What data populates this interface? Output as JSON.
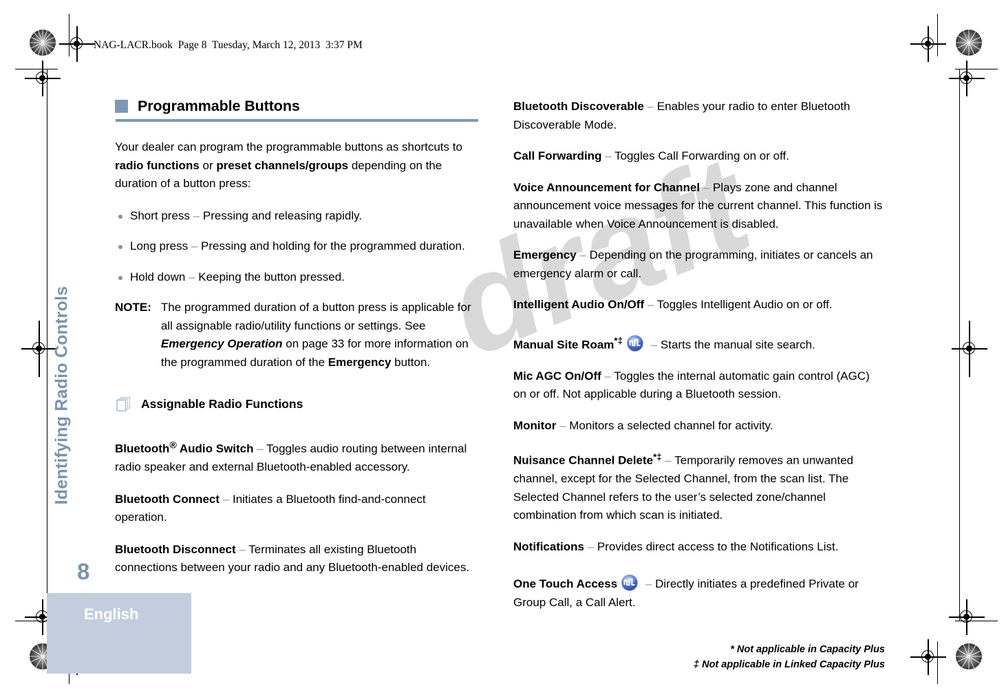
{
  "book_header": "NAG-LACR.book  Page 8  Tuesday, March 12, 2013  3:37 PM",
  "sidebar": {
    "chapter": "Identifying Radio Controls",
    "page_number": "8",
    "language": "English"
  },
  "watermark": "draft",
  "colors": {
    "accent": "#7d99b5",
    "sidebar_band": "#c2cedd",
    "sidebar_text": "#7d93ad",
    "dash": "#8095ad",
    "watermark": "#d9d9d9",
    "icon_blue": "#4a6fd4"
  },
  "left_column": {
    "heading": "Programmable Buttons",
    "heading_icon": "square-bullet-icon",
    "intro": {
      "part1": "Your dealer can program the programmable buttons as shortcuts to ",
      "bold1": "radio functions",
      "part2": " or ",
      "bold2": "preset channels/groups",
      "part3": " depending on the duration of a button press:"
    },
    "bullets": [
      {
        "term": "Short press",
        "dash": "–",
        "desc": " Pressing and releasing rapidly."
      },
      {
        "term": "Long press",
        "dash": "–",
        "desc": " Pressing and holding for the programmed duration."
      },
      {
        "term": "Hold down",
        "dash": "–",
        "desc": " Keeping the button pressed."
      }
    ],
    "note": {
      "label": "NOTE:",
      "part1": "The programmed duration of a button press is applicable for all assignable radio/utility functions or settings. See ",
      "ref": "Emergency Operation",
      "part2": " on page 33 for more information on the programmed duration of the ",
      "bold2": "Emergency",
      "part3": " button."
    },
    "subheading": "Assignable Radio Functions",
    "subheading_icon": "stacked-pages-icon",
    "entries": [
      {
        "term": "Bluetooth",
        "sup": "®",
        "term2": " Audio Switch",
        "dash": "–",
        "desc": " Toggles audio routing between internal radio speaker and external Bluetooth-enabled accessory."
      },
      {
        "term": "Bluetooth Connect",
        "dash": "–",
        "desc": " Initiates a Bluetooth find-and-connect operation."
      },
      {
        "term": "Bluetooth Disconnect",
        "dash": "–",
        "desc": " Terminates all existing Bluetooth connections between your radio and any Bluetooth-enabled devices."
      }
    ]
  },
  "right_column": {
    "entries": [
      {
        "term": "Bluetooth Discoverable",
        "dash": "–",
        "desc": " Enables your radio to enter Bluetooth Discoverable Mode."
      },
      {
        "term": "Call Forwarding",
        "dash": "–",
        "desc": " Toggles Call Forwarding on or off."
      },
      {
        "term": "Voice Announcement for Channel",
        "dash": "–",
        "desc": " Plays zone and channel announcement voice messages for the current channel. This function is unavailable when Voice Announcement is disabled."
      },
      {
        "term": "Emergency",
        "dash": "–",
        "desc": " Depending on the programming, initiates or cancels an emergency alarm or call."
      },
      {
        "term": "Intelligent Audio On/Off",
        "dash": "–",
        "desc": " Toggles Intelligent Audio on or off."
      },
      {
        "term": "Manual Site Roam",
        "marks": "*‡",
        "icon": "site-roam-button-icon",
        "dash": "–",
        "desc": " Starts the manual site search."
      },
      {
        "term": "Mic AGC On/Off",
        "dash": "–",
        "desc": " Toggles the internal  automatic gain control (AGC) on or off. Not applicable during a Bluetooth session."
      },
      {
        "term": "Monitor",
        "dash": "–",
        "desc": " Monitors a selected channel for activity."
      },
      {
        "term": "Nuisance Channel Delete",
        "marks": "*‡",
        "dash": "–",
        "desc": " Temporarily removes an unwanted channel, except for the Selected Channel, from the scan list. The Selected Channel refers to the user’s selected zone/channel combination from which scan is initiated."
      },
      {
        "term": "Notifications",
        "dash": "–",
        "desc": " Provides direct access to the Notifications List."
      },
      {
        "term": "One Touch Access",
        "icon": "one-touch-access-button-icon",
        "dash": "–",
        "desc": " Directly initiates a predefined Private or Group Call, a Call Alert."
      }
    ],
    "footnotes": [
      "* Not applicable in Capacity Plus",
      "‡ Not applicable in Linked Capacity Plus"
    ]
  }
}
